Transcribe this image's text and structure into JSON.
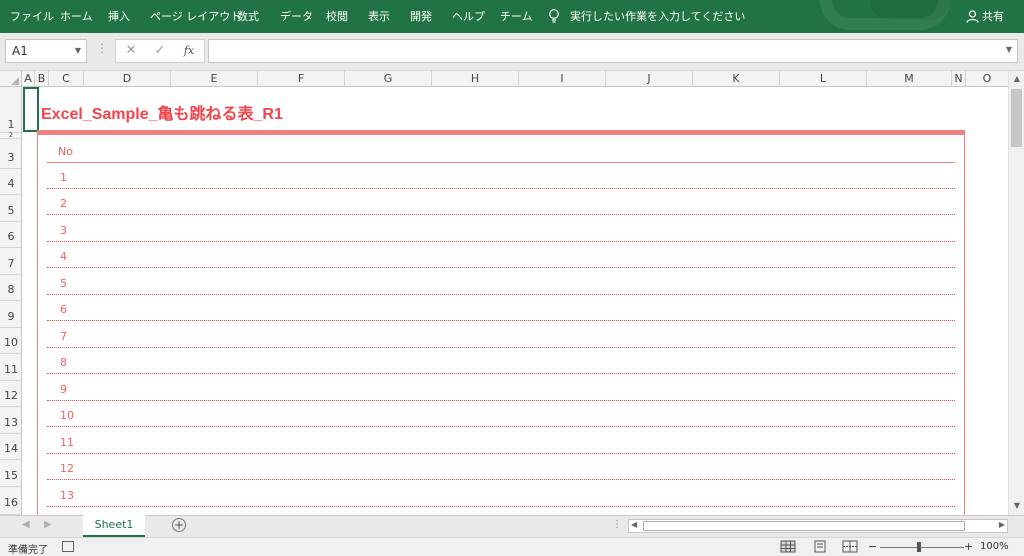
{
  "ribbon": {
    "tabs": [
      "ファイル",
      "ホーム",
      "挿入",
      "ページ レイアウト",
      "数式",
      "データ",
      "校閲",
      "表示",
      "開発",
      "ヘルプ",
      "チーム"
    ],
    "tell_me": "実行したい作業を入力してください",
    "share": "共有",
    "color": "#217346"
  },
  "formula_bar": {
    "name_box": "A1",
    "cancel_icon": "✕",
    "enter_icon": "✓",
    "fx_label": "fx",
    "formula": ""
  },
  "columns": [
    "A",
    "B",
    "C",
    "D",
    "E",
    "F",
    "G",
    "H",
    "I",
    "J",
    "K",
    "L",
    "M",
    "N",
    "O"
  ],
  "rows": [
    "1",
    "2",
    "3",
    "4",
    "5",
    "6",
    "7",
    "8",
    "9",
    "10",
    "11",
    "12",
    "13",
    "14",
    "15",
    "16"
  ],
  "sheet": {
    "title": "Excel_Sample_亀も跳ねる表_R1",
    "header": "No",
    "numbers": [
      "1",
      "2",
      "3",
      "4",
      "5",
      "6",
      "7",
      "8",
      "9",
      "10",
      "11",
      "12",
      "13"
    ],
    "accent": "#f4434a"
  },
  "tabs": {
    "active": "Sheet1"
  },
  "status": {
    "ready": "準備完了",
    "zoom": "100%"
  }
}
